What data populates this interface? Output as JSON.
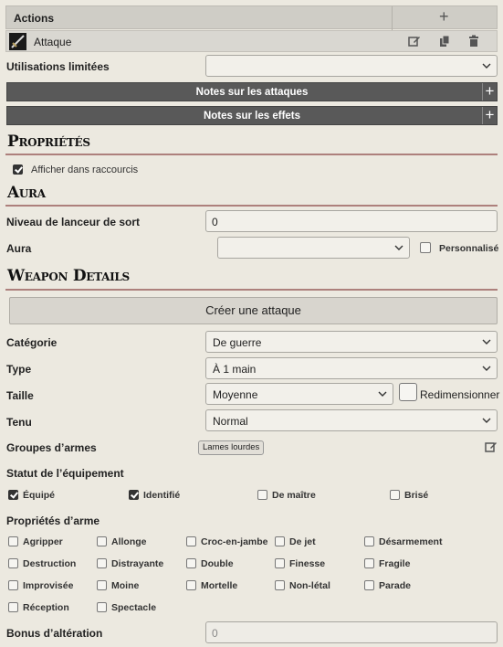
{
  "actions": {
    "title": "Actions",
    "add_icon": "plus-icon"
  },
  "attack": {
    "name": "Attaque",
    "icons": [
      "edit-icon",
      "copy-icon",
      "trash-icon"
    ]
  },
  "limited_uses": {
    "label": "Utilisations limitées",
    "value": ""
  },
  "notes": {
    "attacks": "Notes sur les attaques",
    "effects": "Notes sur les effets"
  },
  "proprietes": {
    "title": "Propriétés",
    "show_shortcuts": {
      "label": "Afficher dans raccourcis",
      "checked": true
    }
  },
  "aura": {
    "title": "Aura",
    "caster_level_label": "Niveau de lanceur de sort",
    "caster_level_value": "0",
    "aura_label": "Aura",
    "aura_value": "",
    "custom_label": "Personnalisé",
    "custom_checked": false
  },
  "weapon": {
    "title": "Weapon Details",
    "create_attack": "Créer une attaque",
    "category_label": "Catégorie",
    "category_value": "De guerre",
    "type_label": "Type",
    "type_value": "À 1 main",
    "size_label": "Taille",
    "size_value": "Moyenne",
    "resize_label": "Redimensionner",
    "resize_checked": false,
    "grip_label": "Tenu",
    "grip_value": "Normal",
    "groups_label": "Groupes d’armes",
    "group_tag": "Lames lourdes",
    "equip_status_label": "Statut de l’équipement",
    "equip_status": [
      {
        "label": "Équipé",
        "checked": true
      },
      {
        "label": "Identifié",
        "checked": true
      },
      {
        "label": "De maître",
        "checked": false
      },
      {
        "label": "Brisé",
        "checked": false
      }
    ],
    "props_label": "Propriétés d’arme",
    "props": [
      "Agripper",
      "Allonge",
      "Croc-en-jambe",
      "De jet",
      "Désarmement",
      "Destruction",
      "Distrayante",
      "Double",
      "Finesse",
      "Fragile",
      "Improvisée",
      "Moine",
      "Mortelle",
      "Non-létal",
      "Parade",
      "Réception",
      "Spectacle"
    ],
    "alteration_label": "Bonus d’altération",
    "alteration_value": "0"
  }
}
